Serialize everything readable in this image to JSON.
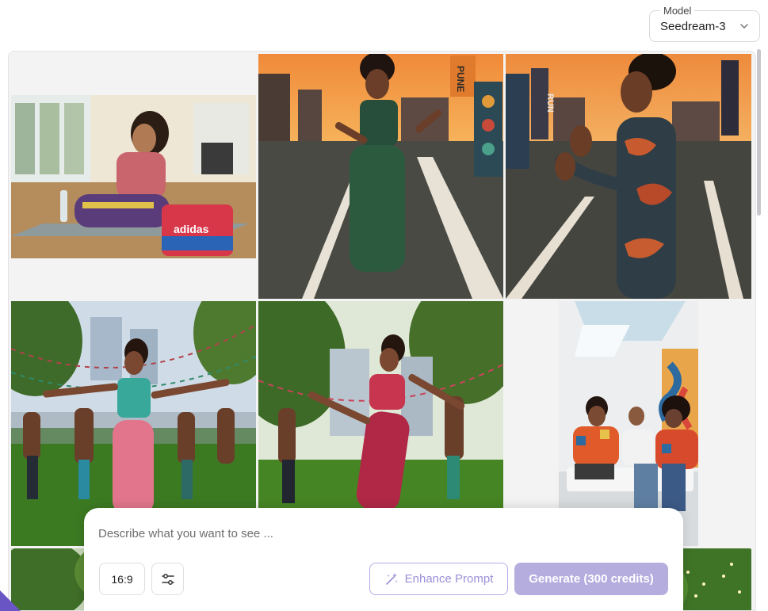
{
  "model": {
    "label": "Model",
    "value": "Seedream-3",
    "chevron_icon": "chevron-down-icon"
  },
  "gallery": {
    "images": [
      {
        "subject": "woman stretching on yoga mat with water bottle and adidas towel in gym",
        "text": "adidas"
      },
      {
        "subject": "woman dancing on rooftop running track at sunset",
        "text": "PUNE"
      },
      {
        "subject": "woman in patterned outfit waving on rooftop at sunset",
        "text": "RUN"
      },
      {
        "subject": "group of women dancing in park festival"
      },
      {
        "subject": "women dancing in sunny park with bunting"
      },
      {
        "subject": "three people sitting on bench in white room with mural"
      },
      {
        "subject": "trees and greenery"
      },
      {
        "subject": "park scene"
      },
      {
        "subject": "trees with string lights"
      }
    ]
  },
  "prompt": {
    "placeholder": "Describe what you want to see ...",
    "value": ""
  },
  "toolbar": {
    "aspect_ratio": "16:9",
    "settings_icon": "sliders-icon",
    "enhance_label": "Enhance Prompt",
    "enhance_icon": "magic-wand-icon",
    "generate_label": "Generate (300 credits)"
  },
  "colors": {
    "accent": "#6a55c5",
    "generate_bg": "#b6addf",
    "enhance_text": "#9d8fd8",
    "enhance_border": "#b7a9e6"
  }
}
